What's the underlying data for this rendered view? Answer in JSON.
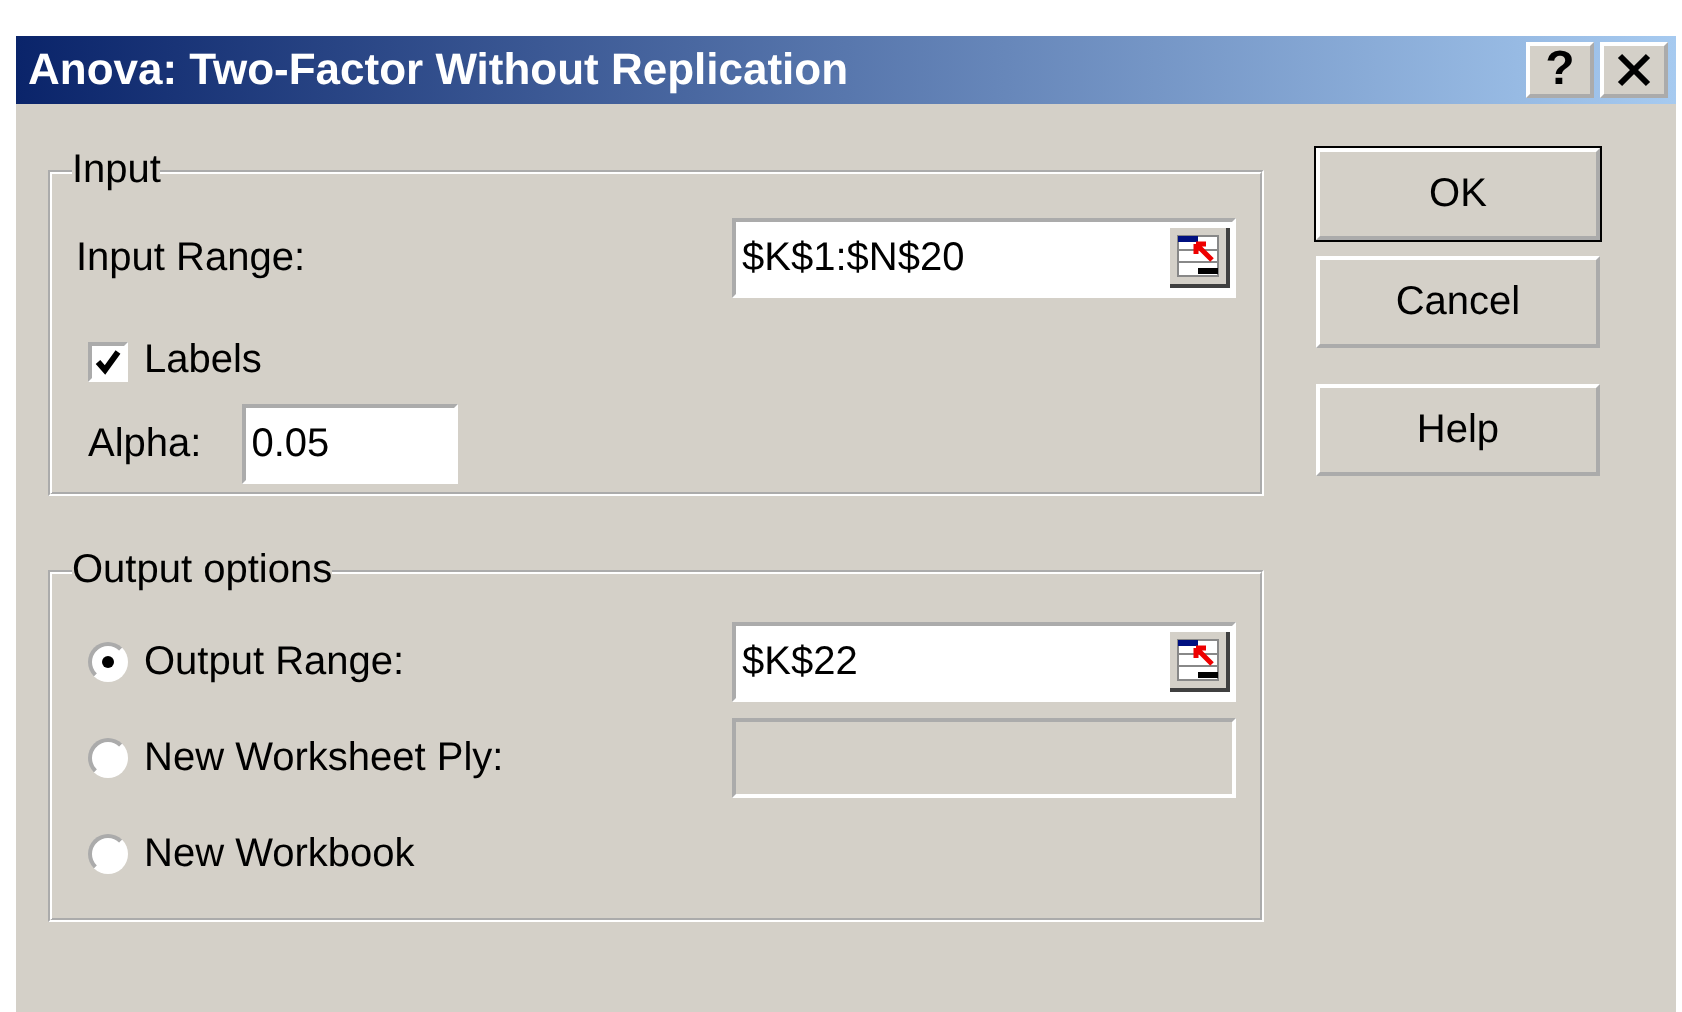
{
  "window": {
    "title": "Anova: Two-Factor Without Replication",
    "help_button": "?"
  },
  "input": {
    "legend": "Input",
    "input_range": {
      "label": "Input Range:",
      "value": "$K$1:$N$20"
    },
    "labels": {
      "label": "Labels",
      "checked": true
    },
    "alpha": {
      "label": "Alpha:",
      "value": "0.05"
    }
  },
  "output_options": {
    "legend": "Output options",
    "options": [
      {
        "label": "Output Range:",
        "selected": true,
        "field": {
          "value": "$K$22",
          "disabled": false
        }
      },
      {
        "label": "New Worksheet Ply:",
        "selected": false,
        "field": {
          "disabled": true
        }
      },
      {
        "label": "New Workbook",
        "selected": false
      }
    ]
  },
  "buttons": [
    "OK",
    "Cancel",
    "Help"
  ]
}
